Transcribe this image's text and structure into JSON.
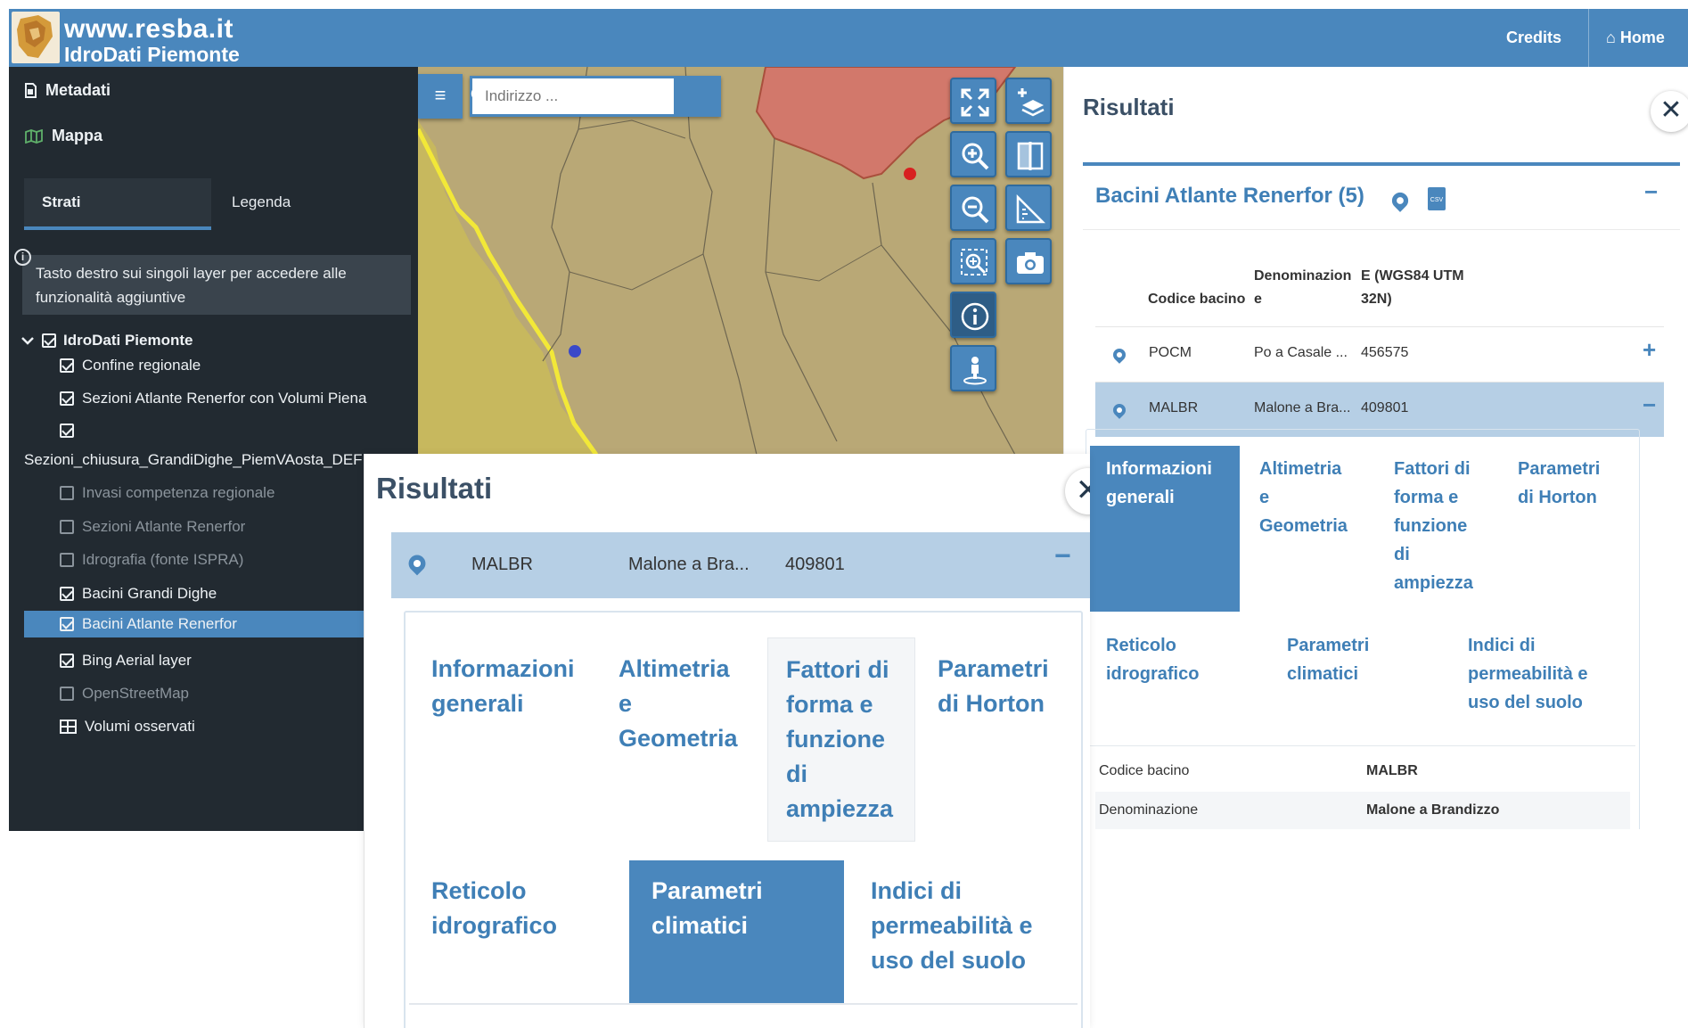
{
  "header": {
    "site_name": "www.resba.it",
    "site_subtitle": "IdroDati Piemonte",
    "credits_label": "Credits",
    "home_label": "Home"
  },
  "sidebar": {
    "metadati_label": "Metadati",
    "mappa_label": "Mappa",
    "tabs": [
      "Strati",
      "Legenda"
    ],
    "info_text_line1": "Tasto destro sui singoli layer per accedere alle",
    "info_text_line2": "funzionalità aggiuntive",
    "root_layer": "IdroDati Piemonte",
    "layers": [
      {
        "label": "Confine regionale",
        "checked": true
      },
      {
        "label": "Sezioni Atlante Renerfor con Volumi Piena",
        "checked": true
      },
      {
        "label": "Sezioni_chiusura_GrandiDighe_PiemVAosta_DEF",
        "checked": true
      },
      {
        "label": "Invasi competenza regionale",
        "checked": false
      },
      {
        "label": "Sezioni Atlante Renerfor",
        "checked": false
      },
      {
        "label": "Idrografia (fonte ISPRA)",
        "checked": false
      },
      {
        "label": "Bacini Grandi Dighe",
        "checked": true
      },
      {
        "label": "Bacini Atlante Renerfor",
        "checked": true,
        "selected": true
      },
      {
        "label": "Bing Aerial layer",
        "checked": true
      },
      {
        "label": "OpenStreetMap",
        "checked": false
      },
      {
        "label": "Volumi osservati",
        "type": "table"
      }
    ]
  },
  "map": {
    "search_placeholder": "Indirizzo ..."
  },
  "results_panel": {
    "title": "Risultati",
    "card_title": "Bacini Atlante Renerfor (5)",
    "columns": [
      "Codice bacino",
      "Denominazion e",
      "E (WGS84 UTM 32N)"
    ],
    "col_denominazione_line1": "Denominazion",
    "col_denominazione_line2": "e",
    "col_e_line1": "E (WGS84 UTM",
    "col_e_line2": "32N)",
    "rows": [
      {
        "codice": "POCM",
        "denominazione": "Po a Casale ...",
        "e": "456575",
        "action": "+"
      },
      {
        "codice": "MALBR",
        "denominazione": "Malone a Bra...",
        "e": "409801",
        "action": "−"
      }
    ],
    "detail_tabs": [
      {
        "label_lines": [
          "Informazioni",
          "generali"
        ],
        "active": true
      },
      {
        "label_lines": [
          "Altimetria",
          "e",
          "Geometria"
        ]
      },
      {
        "label_lines": [
          "Fattori di",
          "forma e",
          "funzione",
          "di",
          "ampiezza"
        ]
      },
      {
        "label_lines": [
          "Parametri",
          "di Horton"
        ]
      },
      {
        "label_lines": [
          "Reticolo",
          "idrografico"
        ]
      },
      {
        "label_lines": [
          "Parametri",
          "climatici"
        ]
      },
      {
        "label_lines": [
          "Indici di",
          "permeabilità e",
          "uso del suolo"
        ]
      }
    ],
    "detail_rows": [
      {
        "key": "Codice bacino",
        "value": "MALBR"
      },
      {
        "key": "Denominazione",
        "value": "Malone a Brandizzo"
      }
    ]
  },
  "zoom_panel": {
    "title": "Risultati",
    "row": {
      "codice": "MALBR",
      "denominazione": "Malone a Bra...",
      "e": "409801",
      "action": "−"
    },
    "tabs": [
      {
        "label_lines": [
          "Informazioni",
          "generali"
        ]
      },
      {
        "label_lines": [
          "Altimetria",
          "e",
          "Geometria"
        ]
      },
      {
        "label_lines": [
          "Fattori di",
          "forma e",
          "funzione",
          "di",
          "ampiezza"
        ],
        "hover": true
      },
      {
        "label_lines": [
          "Parametri",
          "di Horton"
        ]
      },
      {
        "label_lines": [
          "Reticolo",
          "idrografico"
        ]
      },
      {
        "label_lines": [
          "Parametri",
          "climatici"
        ],
        "active": true
      },
      {
        "label_lines": [
          "Indici di",
          "permeabilità e",
          "uso del suolo"
        ]
      }
    ]
  },
  "colors": {
    "brand": "#4a87bd",
    "sidebar_bg": "#222a31",
    "map_region_red": "#d2786b",
    "map_border_yellow": "#f2e838"
  },
  "icons": [
    "file-icon",
    "map-icon",
    "info-icon",
    "menu-icon",
    "search-icon",
    "fullscreen-icon",
    "add-layer-icon",
    "zoom-in-icon",
    "compare-icon",
    "zoom-out-icon",
    "measure-icon",
    "zoom-box-icon",
    "camera-icon",
    "identify-icon",
    "street-view-icon",
    "pin-icon",
    "csv-icon",
    "close-icon",
    "home-icon"
  ]
}
